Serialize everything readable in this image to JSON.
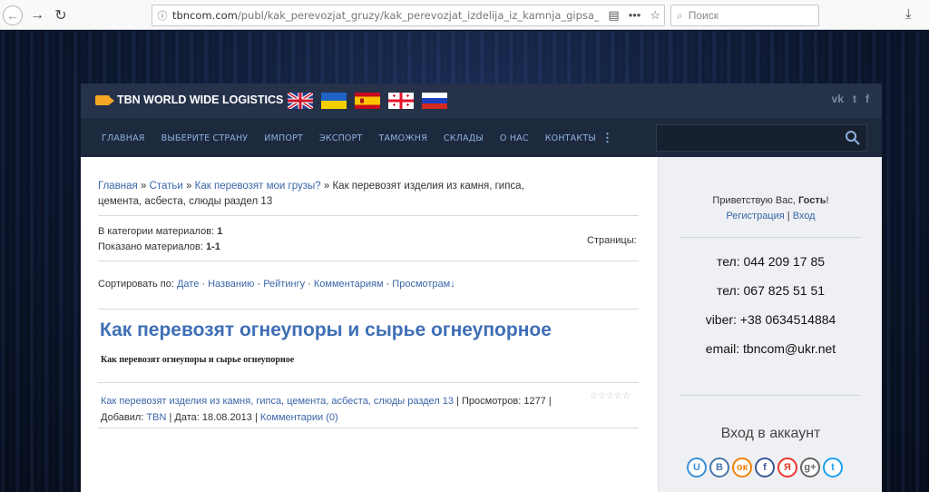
{
  "browser": {
    "url_host": "tbncom.com",
    "url_path": "/publ/kak_perevozjat_gruzy/kak_perevozjat_izdelija_iz_kamnja_gipsa_cementa_...",
    "search_placeholder": "Поиск",
    "icons": [
      "back-icon",
      "forward-icon",
      "reload-icon",
      "info-icon",
      "reader-icon",
      "more-icon",
      "bookmark-star-icon",
      "search-icon",
      "download-icon"
    ]
  },
  "header": {
    "logo_text": "TBN WORLD WIDE LOGISTICS",
    "flags": [
      "uk-flag",
      "ukraine-flag",
      "spain-flag",
      "georgia-flag",
      "russia-flag"
    ],
    "socials": [
      "vk-icon",
      "twitter-icon",
      "facebook-icon"
    ],
    "social_labels": [
      "vk",
      "t",
      "f"
    ]
  },
  "menu": {
    "items": [
      "ГЛАВНАЯ",
      "ВЫБЕРИТЕ СТРАНУ",
      "ИМПОРТ",
      "ЭКСПОРТ",
      "ТАМОЖНЯ",
      "СКЛАДЫ",
      "О НАС",
      "КОНТАКТЫ"
    ],
    "more": "⋮"
  },
  "breadcrumb": {
    "home": "Главная",
    "sep": " » ",
    "articles": "Статьи",
    "category": "Как перевозят мои грузы?",
    "current": "Как перевозят изделия из камня, гипса, цемента, асбеста, слюды раздел 13"
  },
  "stats": {
    "in_category_label": "В категории материалов: ",
    "in_category_value": "1",
    "shown_label": "Показано материалов: ",
    "shown_value": "1-1",
    "pages_label": "Страницы:"
  },
  "sort": {
    "label": "Сортировать по: ",
    "options": [
      "Дате",
      "Названию",
      "Рейтингу",
      "Комментариям",
      "Просмотрам"
    ],
    "arrow": "↓"
  },
  "article": {
    "title": "Как перевозят огнеупоры и сырье огнеупорное",
    "subtitle": "Как перевозят огнеупоры и сырье огнеупорное",
    "category_link": "Как перевозят изделия из камня, гипса, цемента, асбеста, слюды раздел 13",
    "views_label": "Просмотров: ",
    "views": "1277",
    "added_label": "Добавил: ",
    "author": "TBN",
    "date_label": "Дата: ",
    "date": "18.08.2013",
    "comments": "Комментарии (0)",
    "rating_stars": 5,
    "rating_value": 0
  },
  "sidebar": {
    "greeting": "Приветствую Вас, ",
    "guest": "Гость",
    "excl": "!",
    "register": "Регистрация",
    "login": "Вход",
    "phones": [
      "тел:  044 209 17 85",
      "тел:  067 825 51 51",
      "viber:  +38 0634514884",
      "email: tbncom@ukr.net"
    ],
    "login_title": "Вход в аккаунт",
    "login_providers": [
      {
        "name": "ucoz-icon",
        "glyph": "U",
        "color": "#3a8fd6"
      },
      {
        "name": "vk-login-icon",
        "glyph": "В",
        "color": "#4a76a8"
      },
      {
        "name": "odnoklassniki-icon",
        "glyph": "ок",
        "color": "#ee8208"
      },
      {
        "name": "facebook-login-icon",
        "glyph": "f",
        "color": "#3b5998"
      },
      {
        "name": "yandex-icon",
        "glyph": "Я",
        "color": "#e8372c"
      },
      {
        "name": "google-plus-icon",
        "glyph": "g+",
        "color": "#666666"
      },
      {
        "name": "twitter-login-icon",
        "glyph": "t",
        "color": "#1da1f2"
      }
    ]
  }
}
